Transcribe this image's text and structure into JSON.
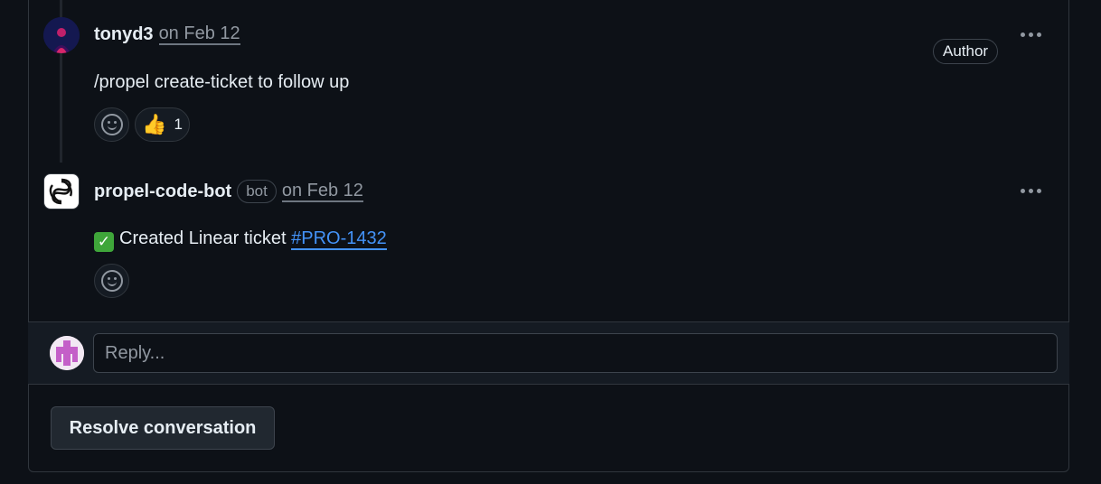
{
  "comments": [
    {
      "author": "tonyd3",
      "date": "on Feb 12",
      "badge": "Author",
      "body": "/propel create-ticket to follow up",
      "reactions": [
        {
          "emoji": "👍",
          "count": "1"
        }
      ]
    },
    {
      "author": "propel-code-bot",
      "tag": "bot",
      "date": "on Feb 12",
      "body_prefix": "Created Linear ticket ",
      "body_link": "#PRO-1432"
    }
  ],
  "reply": {
    "placeholder": "Reply..."
  },
  "resolve": {
    "label": "Resolve conversation"
  },
  "colors": {
    "link": "#4493f8",
    "background": "#0d1117",
    "check": "#3fa63a"
  }
}
